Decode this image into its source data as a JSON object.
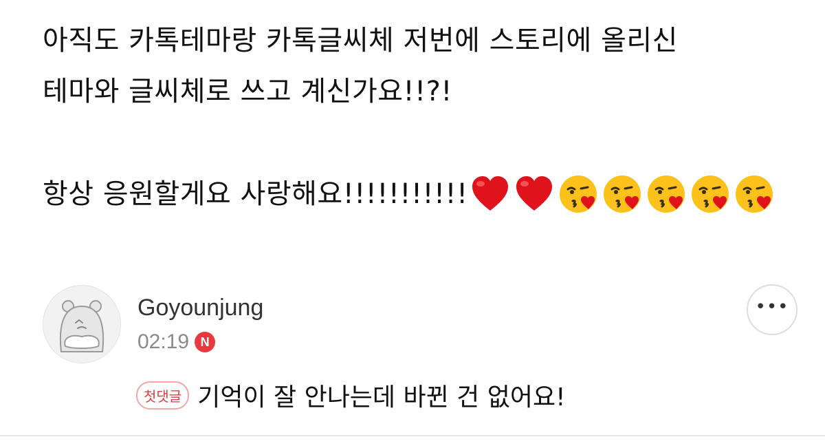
{
  "post": {
    "line1": "아직도 카톡테마랑 카톡글씨체 저번에 스토리에 올리신",
    "line2": "테마와 글씨체로 쓰고 계신가요!!?!",
    "line3": "항상 응원할게요 사랑해요!!!!!!!!!!!"
  },
  "emojis": [
    "red-heart",
    "red-heart",
    "kissing-face-with-heart",
    "kissing-face-with-heart",
    "kissing-face-with-heart",
    "kissing-face-with-heart",
    "kissing-face-with-heart"
  ],
  "comment": {
    "username": "Goyounjung",
    "time": "02:19",
    "new_badge": "N",
    "first_badge": "첫댓글",
    "text": "기억이 잘 안나는데 바뀐 건 없어요!",
    "more_label": "•••"
  },
  "colors": {
    "badge_red": "#e8393f",
    "badge_border": "#f2a7a7",
    "muted_text": "#8a8a8a"
  }
}
